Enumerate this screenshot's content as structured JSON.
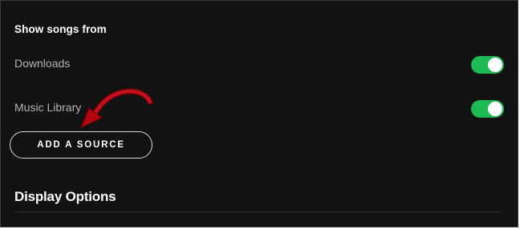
{
  "settings": {
    "show_songs_label": "Show songs from",
    "sources": [
      {
        "label": "Downloads",
        "enabled": true
      },
      {
        "label": "Music Library",
        "enabled": true
      }
    ],
    "add_source_label": "ADD A SOURCE",
    "display_options_title": "Display Options"
  },
  "colors": {
    "background": "#121212",
    "toggle_on": "#1db954",
    "annotation_arrow": "#b3050f"
  },
  "icons": {
    "annotation": "red-curved-arrow-icon"
  }
}
